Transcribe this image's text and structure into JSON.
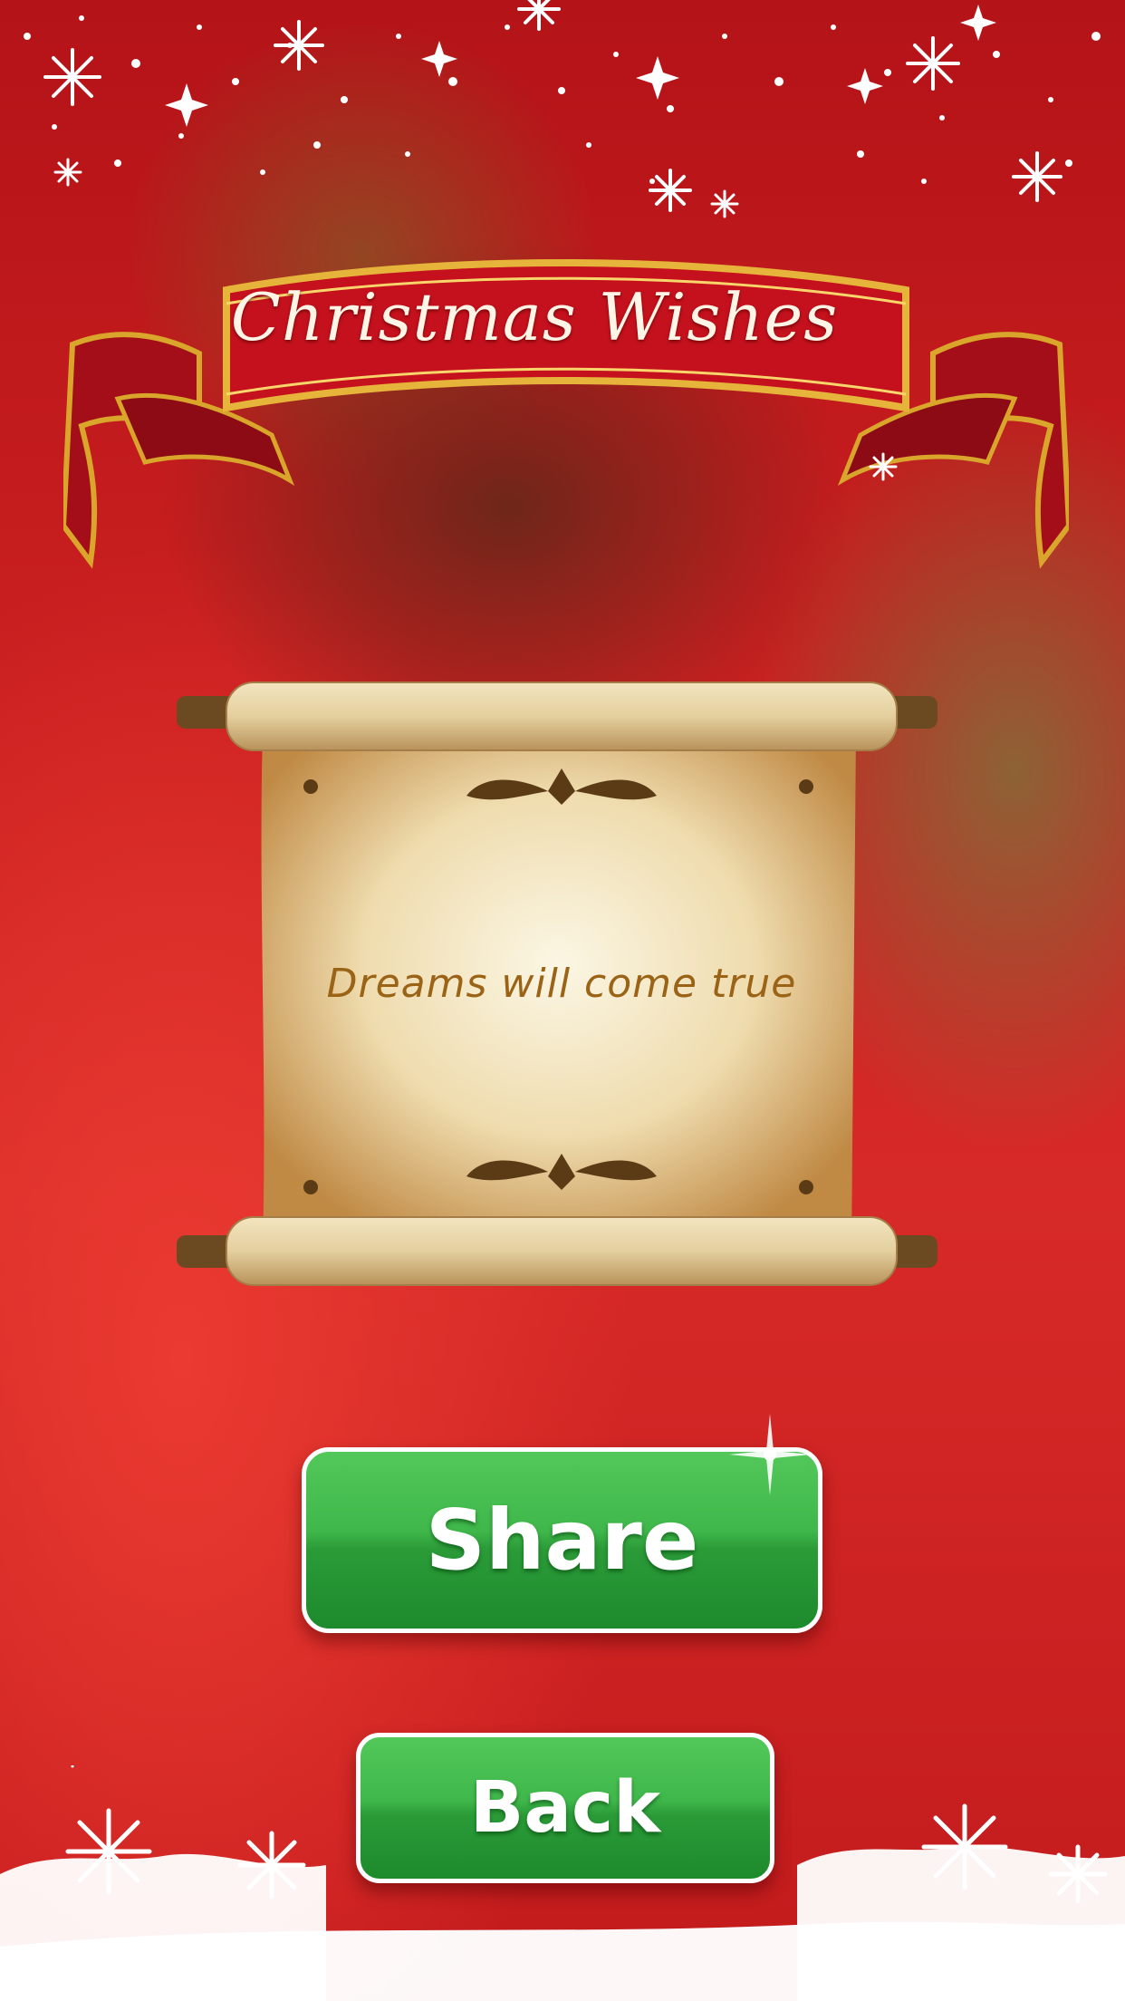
{
  "header": {
    "title": "Christmas Wishes"
  },
  "scroll": {
    "message": "Dreams will come true"
  },
  "buttons": {
    "share_label": "Share",
    "back_label": "Back"
  },
  "icons": [
    "snowflake-icon",
    "ribbon-banner",
    "scroll-ornament-icon",
    "sparkle-icon"
  ],
  "colors": {
    "background": "#c81e1f",
    "button_green": "#2b9b38",
    "scroll_text": "#9a6316",
    "ribbon_red": "#c4111d",
    "gold": "#d9a52b"
  }
}
